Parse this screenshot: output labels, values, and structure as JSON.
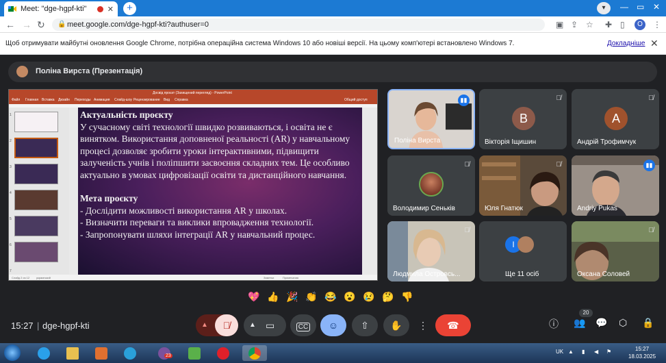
{
  "browser": {
    "tab_title": "Meet: \"dge-hgpf-kti\"",
    "url": "meet.google.com/dge-hgpf-kti?authuser=0",
    "profile_letter": "O",
    "infobar_message": "Щоб отримувати майбутні оновлення Google Chrome, потрібна операційна система Windows 10 або новіші версії. На цьому комп'ютері встановлено Windows 7.",
    "infobar_link": "Докладніше"
  },
  "meet": {
    "presenter_label": "Поліна Вирста (Презентація)",
    "time": "15:27",
    "meeting_code": "dge-hgpf-kti",
    "people_count": "20",
    "participants": [
      {
        "name": "Поліна Вирста",
        "speaking": true
      },
      {
        "name": "Вікторія Іщишин",
        "initial": "В",
        "color": "#8d5a4a"
      },
      {
        "name": "Андрій Трофимчук",
        "initial": "А",
        "color": "#a0522d"
      },
      {
        "name": "Володимир Сеньків"
      },
      {
        "name": "Юля Гнатюк"
      },
      {
        "name": "Andriy Pukas",
        "speaking": true
      },
      {
        "name": "Людмила Островсь..."
      },
      {
        "name": "Ще 11 осіб",
        "initial": "I"
      },
      {
        "name": "Оксана Соловей"
      }
    ],
    "reactions": [
      "💖",
      "👍",
      "🎉",
      "👏",
      "😂",
      "😮",
      "😢",
      "🤔",
      "👎"
    ]
  },
  "powerpoint": {
    "window_title": "Досвід проєкт (Захищений перегляд) - PowerPoint",
    "ribbon_tabs": [
      "Файл",
      "Главная",
      "Вставка",
      "Дизайн",
      "Переходы",
      "Анимация",
      "Слайд-шоу",
      "Рецензирование",
      "Вид",
      "Справка"
    ],
    "share_label": "Общий доступ",
    "status_left": "Слайд 2 из 12",
    "status_lang": "украинский",
    "status_notes": "Заметки",
    "status_comments": "Примечания",
    "slide": {
      "heading1": "Актуальність проєкту",
      "paragraph": "У сучасному світі технології швидко розвиваються, і освіта не є винятком. Використання доповненої реальності (AR) у навчальному процесі дозволяє зробити уроки інтерактивними, підвищити залученість учнів і поліпшити засвоєння складних тем. Це особливо актуально в умовах цифровізації освіти та дистанційного навчання.",
      "heading2": "Мета проєкту",
      "bullets": [
        "- Дослідити можливості використання AR у школах.",
        "- Визначити переваги та виклики впровадження технології.",
        "- Запропонувати шляхи інтеграції AR у навчальний процес."
      ]
    }
  },
  "taskbar": {
    "lang": "UK",
    "clock_time": "15:27",
    "clock_date": "18.03.2025",
    "badge_count": "23"
  },
  "colors": {
    "meet_bg": "#202124",
    "tile_bg": "#3c4043",
    "end_call": "#ea4335",
    "accent_blue": "#1a73e8",
    "pp_red": "#b7472a"
  }
}
